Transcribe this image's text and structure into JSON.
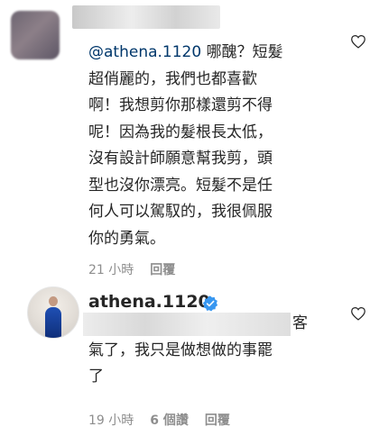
{
  "comment1": {
    "mention": "@athena.1120",
    "lines": [
      " 哪醜？短髮",
      "超俏麗的，我們也都喜歡",
      "啊！我想剪你那樣還剪不得",
      "呢！因為我的髮根長太低，",
      "沒有設計師願意幫我剪，頭",
      "型也沒你漂亮。短髮不是任",
      "何人可以駕馭的，我很佩服",
      "你的勇氣。"
    ],
    "time": "21 小時",
    "reply_label": "回覆"
  },
  "comment2": {
    "username": "athena.1120",
    "lines": [
      "客",
      "氣了，我只是做想做的事罷",
      "了"
    ],
    "time": "19 小時",
    "likes": "6 個讚",
    "reply_label": "回覆"
  },
  "icons": {
    "like": "heart-outline-icon",
    "verified": "verified-badge-icon"
  }
}
